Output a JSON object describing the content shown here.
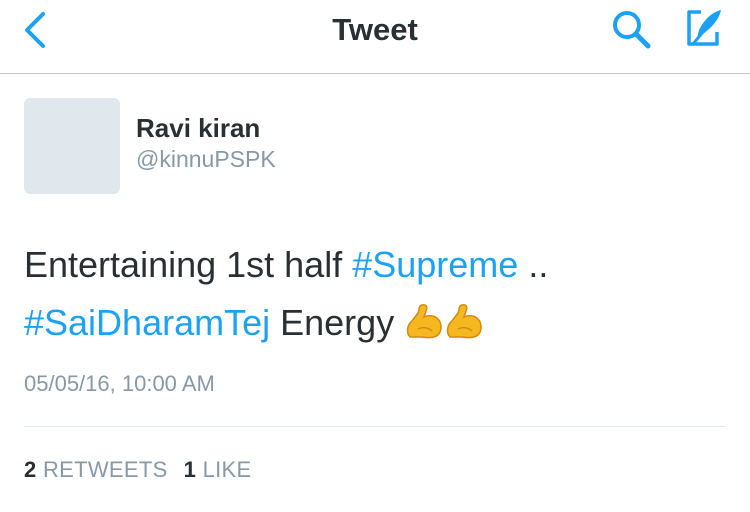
{
  "navbar": {
    "title": "Tweet",
    "back_icon": "chevron-left-icon",
    "search_icon": "search-icon",
    "compose_icon": "compose-icon",
    "accent_color": "#1da1f2"
  },
  "tweet": {
    "author": {
      "name": "Ravi kiran",
      "handle": "@kinnuPSPK"
    },
    "text_line1": {
      "plain": "Entertaining 1st half ",
      "hashtag": "#Supreme",
      "suffix": " .."
    },
    "text_line2": {
      "hashtag": "#SaiDharamTej",
      "plain": " Energy ",
      "emoji": "flexed-biceps-icon"
    },
    "timestamp": "05/05/16, 10:00 AM",
    "stats": {
      "retweets_count": "2",
      "retweets_label": "RETWEETS",
      "likes_count": "1",
      "likes_label": "LIKE"
    }
  }
}
